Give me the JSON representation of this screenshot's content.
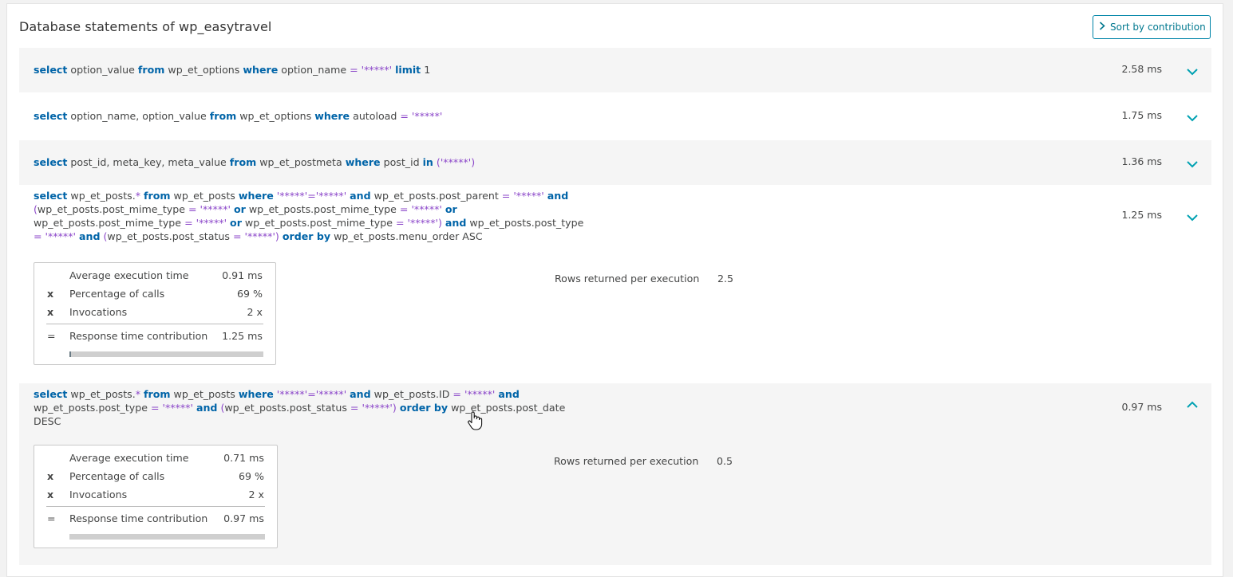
{
  "header": {
    "title": "Database statements of wp_easytravel",
    "sort_label": "Sort by contribution"
  },
  "statements": [
    {
      "duration": "2.58 ms",
      "lines": [
        [
          [
            "kw",
            "select"
          ],
          [
            "t",
            " option_value "
          ],
          [
            "kw",
            "from"
          ],
          [
            "t",
            " wp_et_options "
          ],
          [
            "kw",
            "where"
          ],
          [
            "t",
            " option_name "
          ],
          [
            "op",
            "= '*****'"
          ],
          [
            "t",
            " "
          ],
          [
            "kw",
            "limit"
          ],
          [
            "t",
            " 1"
          ]
        ]
      ]
    },
    {
      "duration": "1.75 ms",
      "lines": [
        [
          [
            "kw",
            "select"
          ],
          [
            "t",
            " option_name, option_value "
          ],
          [
            "kw",
            "from"
          ],
          [
            "t",
            " wp_et_options "
          ],
          [
            "kw",
            "where"
          ],
          [
            "t",
            " autoload "
          ],
          [
            "op",
            "= '*****'"
          ]
        ]
      ]
    },
    {
      "duration": "1.36 ms",
      "lines": [
        [
          [
            "kw",
            "select"
          ],
          [
            "t",
            " post_id, meta_key, meta_value "
          ],
          [
            "kw",
            "from"
          ],
          [
            "t",
            " wp_et_postmeta "
          ],
          [
            "kw",
            "where"
          ],
          [
            "t",
            " post_id "
          ],
          [
            "kw",
            "in"
          ],
          [
            "t",
            " "
          ],
          [
            "op",
            "('*****')"
          ]
        ]
      ]
    },
    {
      "duration": "1.25 ms",
      "lines": [
        [
          [
            "kw",
            "select"
          ],
          [
            "t",
            " wp_et_posts."
          ],
          [
            "op",
            "*"
          ],
          [
            "t",
            " "
          ],
          [
            "kw",
            "from"
          ],
          [
            "t",
            " wp_et_posts "
          ],
          [
            "kw",
            "where"
          ],
          [
            "t",
            " "
          ],
          [
            "op",
            "'*****'='*****'"
          ],
          [
            "t",
            " "
          ],
          [
            "kw",
            "and"
          ],
          [
            "t",
            " wp_et_posts.post_parent "
          ],
          [
            "op",
            "= '*****'"
          ],
          [
            "t",
            " "
          ],
          [
            "kw",
            "and"
          ]
        ],
        [
          [
            "op",
            "("
          ],
          [
            "t",
            "wp_et_posts.post_mime_type "
          ],
          [
            "op",
            "= '*****'"
          ],
          [
            "t",
            " "
          ],
          [
            "kw",
            "or"
          ],
          [
            "t",
            " wp_et_posts.post_mime_type "
          ],
          [
            "op",
            "= '*****'"
          ],
          [
            "t",
            " "
          ],
          [
            "kw",
            "or"
          ]
        ],
        [
          [
            "t",
            "wp_et_posts.post_mime_type "
          ],
          [
            "op",
            "= '*****'"
          ],
          [
            "t",
            " "
          ],
          [
            "kw",
            "or"
          ],
          [
            "t",
            " wp_et_posts.post_mime_type "
          ],
          [
            "op",
            "= '*****')"
          ],
          [
            "t",
            " "
          ],
          [
            "kw",
            "and"
          ],
          [
            "t",
            " wp_et_posts.post_type"
          ]
        ],
        [
          [
            "op",
            "= '*****'"
          ],
          [
            "t",
            " "
          ],
          [
            "kw",
            "and"
          ],
          [
            "t",
            " "
          ],
          [
            "op",
            "("
          ],
          [
            "t",
            "wp_et_posts.post_status "
          ],
          [
            "op",
            "= '*****')"
          ],
          [
            "t",
            " "
          ],
          [
            "kw",
            "order by"
          ],
          [
            "t",
            " wp_et_posts.menu_order ASC"
          ]
        ]
      ],
      "metrics": {
        "avg_label": "Average execution time",
        "avg_value": "0.91 ms",
        "pct_op": "x",
        "pct_label": "Percentage of calls",
        "pct_value": "69 %",
        "inv_op": "x",
        "inv_label": "Invocations",
        "inv_value": "2 x",
        "eq_op": "=",
        "contrib_label": "Response time contribution",
        "contrib_value": "1.25 ms",
        "bar_fraction": 0.01
      },
      "rows_label": "Rows returned per execution",
      "rows_value": "2.5"
    },
    {
      "duration": "0.97 ms",
      "lines": [
        [
          [
            "kw",
            "select"
          ],
          [
            "t",
            " wp_et_posts."
          ],
          [
            "op",
            "*"
          ],
          [
            "t",
            " "
          ],
          [
            "kw",
            "from"
          ],
          [
            "t",
            " wp_et_posts "
          ],
          [
            "kw",
            "where"
          ],
          [
            "t",
            " "
          ],
          [
            "op",
            "'*****'='*****'"
          ],
          [
            "t",
            " "
          ],
          [
            "kw",
            "and"
          ],
          [
            "t",
            " wp_et_posts.ID "
          ],
          [
            "op",
            "= '*****'"
          ],
          [
            "t",
            " "
          ],
          [
            "kw",
            "and"
          ]
        ],
        [
          [
            "t",
            "wp_et_posts.post_type "
          ],
          [
            "op",
            "= '*****'"
          ],
          [
            "t",
            " "
          ],
          [
            "kw",
            "and"
          ],
          [
            "t",
            " "
          ],
          [
            "op",
            "("
          ],
          [
            "t",
            "wp_et_posts.post_status "
          ],
          [
            "op",
            "= '*****')"
          ],
          [
            "t",
            " "
          ],
          [
            "kw",
            "order by"
          ],
          [
            "t",
            " wp_et_posts.post_date"
          ]
        ],
        [
          [
            "t",
            "DESC"
          ]
        ]
      ],
      "metrics": {
        "avg_label": "Average execution time",
        "avg_value": "0.71 ms",
        "pct_op": "x",
        "pct_label": "Percentage of calls",
        "pct_value": "69 %",
        "inv_op": "x",
        "inv_label": "Invocations",
        "inv_value": "2 x",
        "eq_op": "=",
        "contrib_label": "Response time contribution",
        "contrib_value": "0.97 ms",
        "bar_fraction": 0.0
      },
      "rows_label": "Rows returned per execution",
      "rows_value": "0.5"
    }
  ],
  "icons": {
    "sort": "chevron-right-icon",
    "expand": "chevron-down-icon",
    "collapse": "chevron-up-icon",
    "cursor": "hand-pointer-icon"
  },
  "colors": {
    "keyword": "#0064a8",
    "operator": "#8b46c9",
    "accent": "#00a1b2"
  }
}
